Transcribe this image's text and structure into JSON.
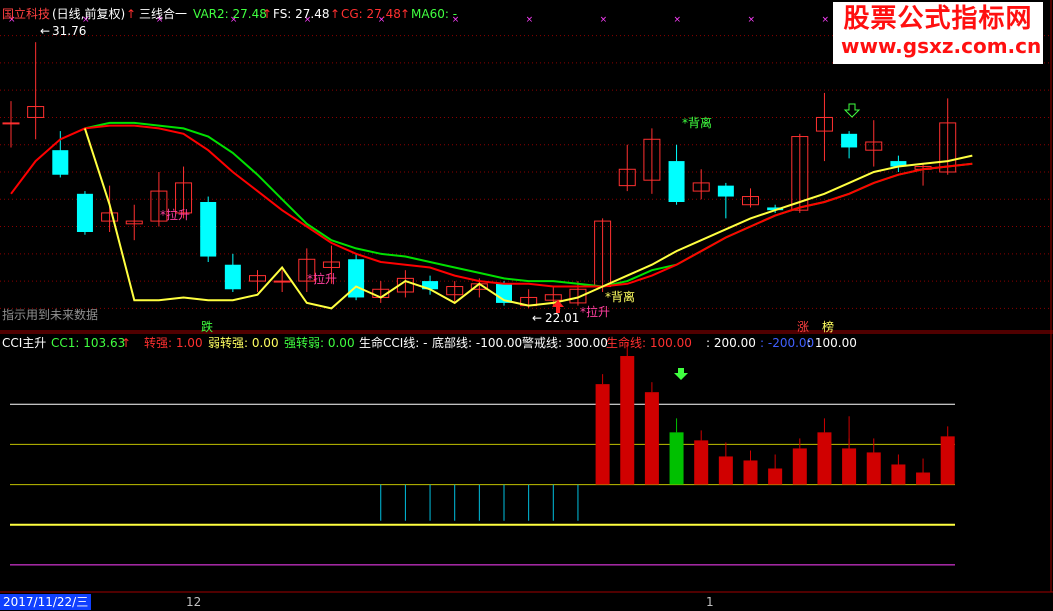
{
  "header": {
    "stock_name": "国立科技",
    "period": "(日线,前复权)",
    "indicator_name": "三线合一",
    "var2_label": "VAR2: 27.48",
    "fs_label": "FS: 27.48",
    "cg_label": "CG: 27.48",
    "ma60_label": "MA60: -"
  },
  "watermark": {
    "main": "股票公式指标网",
    "url": "www.gsxz.com.cn"
  },
  "price_annotations": {
    "high": "31.76",
    "low": "22.01",
    "lashen_1": "*拉升",
    "lashen_2": "*拉升",
    "lashen_3": "*拉升",
    "beili_1": "*背离",
    "beili_2": "*背离",
    "future_note": "指示用到未来数据",
    "die": "跌",
    "zhang": "涨",
    "bang": "榜"
  },
  "indicator_header": {
    "name": "CCI主升",
    "cc1": "CC1: 103.63",
    "zhuanqiang": "转强: 1.00",
    "ruozhuanqiang": "弱转强: 0.00",
    "qiangzhuanruo": "强转弱: 0.00",
    "shengming_cci": "生命CCI线: -",
    "dibu": "底部线: -100.00",
    "jingjie": "警戒线: 300.00",
    "shengmingxian": "生命线: 100.00",
    "v200": ": 200.00",
    "vneg200": ": -200.00",
    "v100": ": 100.00"
  },
  "axis": {
    "date": "2017/11/22/三",
    "tick_12": "12",
    "tick_1": "1"
  },
  "colors": {
    "up": "#ff3030",
    "down": "#00ffff",
    "ma_red": "#ff0000",
    "ma_green": "#00e000",
    "ma_yellow": "#ffff40",
    "grid": "#8b0000",
    "magenta": "#ff40ff"
  },
  "chart_data": {
    "type": "candlestick",
    "price_range": [
      21.5,
      32.5
    ],
    "candles": [
      {
        "o": 28.8,
        "c": 28.8,
        "h": 29.6,
        "l": 27.9
      },
      {
        "o": 29.0,
        "c": 29.4,
        "h": 31.76,
        "l": 28.2
      },
      {
        "o": 27.8,
        "c": 26.9,
        "h": 28.5,
        "l": 26.8
      },
      {
        "o": 26.2,
        "c": 24.8,
        "h": 26.3,
        "l": 24.7
      },
      {
        "o": 25.2,
        "c": 25.5,
        "h": 26.5,
        "l": 24.8
      },
      {
        "o": 25.1,
        "c": 25.2,
        "h": 25.8,
        "l": 24.5
      },
      {
        "o": 25.2,
        "c": 26.3,
        "h": 27.0,
        "l": 25.0
      },
      {
        "o": 25.5,
        "c": 26.6,
        "h": 27.2,
        "l": 25.3
      },
      {
        "o": 25.9,
        "c": 23.9,
        "h": 26.1,
        "l": 23.7
      },
      {
        "o": 23.6,
        "c": 22.7,
        "h": 24.0,
        "l": 22.6
      },
      {
        "o": 23.0,
        "c": 23.2,
        "h": 23.4,
        "l": 22.6
      },
      {
        "o": 23.0,
        "c": 23.0,
        "h": 23.4,
        "l": 22.6
      },
      {
        "o": 23.0,
        "c": 23.8,
        "h": 24.2,
        "l": 22.6
      },
      {
        "o": 23.5,
        "c": 23.7,
        "h": 24.3,
        "l": 22.9
      },
      {
        "o": 23.8,
        "c": 22.4,
        "h": 24.0,
        "l": 22.3
      },
      {
        "o": 22.4,
        "c": 22.7,
        "h": 23.0,
        "l": 22.2
      },
      {
        "o": 22.6,
        "c": 23.1,
        "h": 23.4,
        "l": 22.4
      },
      {
        "o": 23.0,
        "c": 22.7,
        "h": 23.2,
        "l": 22.5
      },
      {
        "o": 22.5,
        "c": 22.8,
        "h": 23.0,
        "l": 22.2
      },
      {
        "o": 22.7,
        "c": 22.9,
        "h": 23.1,
        "l": 22.4
      },
      {
        "o": 22.9,
        "c": 22.2,
        "h": 23.0,
        "l": 22.1
      },
      {
        "o": 22.1,
        "c": 22.4,
        "h": 22.7,
        "l": 22.01
      },
      {
        "o": 22.3,
        "c": 22.5,
        "h": 22.8,
        "l": 22.1
      },
      {
        "o": 22.2,
        "c": 22.7,
        "h": 23.0,
        "l": 22.1
      },
      {
        "o": 22.8,
        "c": 25.2,
        "h": 25.3,
        "l": 22.6
      },
      {
        "o": 26.5,
        "c": 27.1,
        "h": 28.0,
        "l": 26.3
      },
      {
        "o": 26.7,
        "c": 28.2,
        "h": 28.6,
        "l": 26.2
      },
      {
        "o": 27.4,
        "c": 25.9,
        "h": 28.0,
        "l": 25.8
      },
      {
        "o": 26.3,
        "c": 26.6,
        "h": 27.1,
        "l": 26.0
      },
      {
        "o": 26.5,
        "c": 26.1,
        "h": 26.6,
        "l": 25.3
      },
      {
        "o": 25.8,
        "c": 26.1,
        "h": 26.4,
        "l": 25.7
      },
      {
        "o": 25.7,
        "c": 25.6,
        "h": 25.8,
        "l": 25.5
      },
      {
        "o": 25.6,
        "c": 28.3,
        "h": 28.4,
        "l": 25.5
      },
      {
        "o": 28.5,
        "c": 29.0,
        "h": 29.9,
        "l": 27.4
      },
      {
        "o": 28.4,
        "c": 27.9,
        "h": 28.5,
        "l": 27.5
      },
      {
        "o": 27.8,
        "c": 28.1,
        "h": 28.9,
        "l": 27.2
      },
      {
        "o": 27.4,
        "c": 27.2,
        "h": 27.6,
        "l": 27.0
      },
      {
        "o": 27.1,
        "c": 27.2,
        "h": 27.3,
        "l": 26.5
      },
      {
        "o": 27.0,
        "c": 28.8,
        "h": 29.7,
        "l": 26.9
      }
    ],
    "ma_red": [
      26.2,
      27.4,
      28.2,
      28.6,
      28.7,
      28.7,
      28.6,
      28.4,
      27.8,
      27.0,
      26.3,
      25.6,
      25.0,
      24.4,
      24.0,
      23.7,
      23.6,
      23.5,
      23.2,
      23.0,
      22.9,
      22.9,
      22.8,
      22.8,
      22.8,
      22.9,
      23.2,
      23.6,
      24.1,
      24.6,
      25.0,
      25.4,
      25.7,
      25.9,
      26.2,
      26.6,
      26.9,
      27.1,
      27.2,
      27.3
    ],
    "ma_green": [
      null,
      null,
      null,
      28.6,
      28.8,
      28.8,
      28.7,
      28.6,
      28.3,
      27.7,
      26.9,
      26.0,
      25.1,
      24.5,
      24.2,
      24.0,
      23.9,
      23.7,
      23.5,
      23.3,
      23.1,
      23.0,
      23.0,
      22.9,
      22.8,
      23.0,
      23.4,
      23.6,
      24.1,
      24.6,
      25.0,
      25.4,
      25.7,
      25.9,
      26.2,
      26.6,
      26.9,
      27.1,
      27.2,
      27.3
    ],
    "ma_yellow": [
      null,
      null,
      null,
      28.6,
      25.8,
      22.3,
      22.3,
      22.4,
      22.3,
      22.3,
      22.5,
      23.5,
      22.2,
      22.0,
      22.8,
      22.4,
      23.0,
      22.7,
      22.2,
      22.9,
      22.3,
      22.1,
      22.2,
      22.4,
      22.8,
      23.2,
      23.6,
      24.1,
      24.5,
      24.9,
      25.3,
      25.6,
      25.9,
      26.2,
      26.6,
      27.0,
      27.2,
      27.3,
      27.4,
      27.6
    ],
    "cci_bars": [
      null,
      null,
      null,
      null,
      null,
      null,
      null,
      null,
      null,
      null,
      null,
      null,
      null,
      null,
      null,
      -90,
      -90,
      -90,
      -90,
      -90,
      -90,
      -90,
      -90,
      -90,
      250,
      320,
      230,
      130,
      110,
      70,
      60,
      40,
      90,
      130,
      90,
      80,
      50,
      30,
      120
    ],
    "cci_wick_top": [
      null,
      null,
      null,
      null,
      null,
      null,
      null,
      null,
      null,
      null,
      null,
      null,
      null,
      null,
      null,
      null,
      null,
      null,
      null,
      null,
      null,
      null,
      null,
      null,
      null,
      null,
      null,
      null,
      null,
      null,
      null,
      null,
      null,
      null,
      170,
      null,
      null,
      null,
      null
    ],
    "cci_ref_lines": [
      200,
      100,
      0,
      -100,
      -200
    ],
    "cci_range": [
      -250,
      330
    ]
  }
}
